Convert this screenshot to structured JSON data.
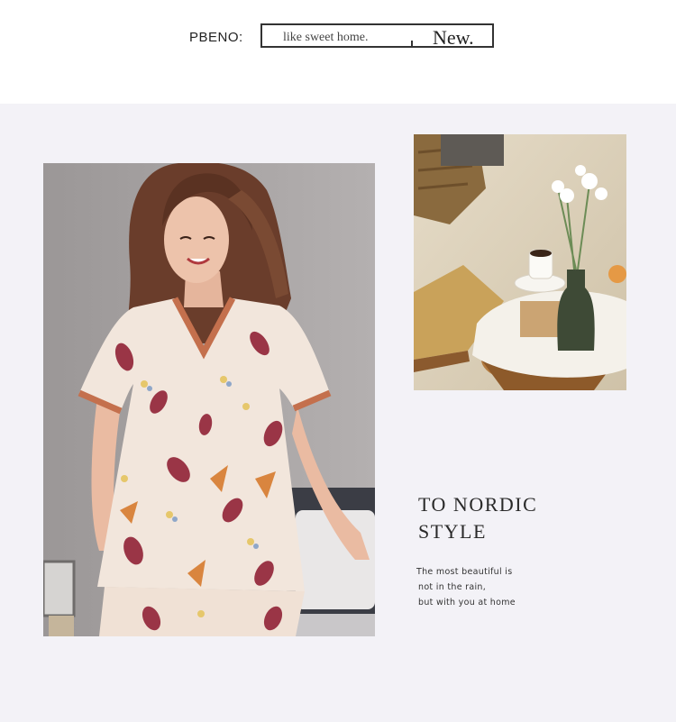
{
  "header": {
    "brand": "PBENO:",
    "tagline_left": "like sweet home.",
    "tagline_right": "New."
  },
  "feature": {
    "headline_line1": "TO NORDIC",
    "headline_line2": "STYLE",
    "caption_line1": "The most beautiful is",
    "caption_line2": "not in the rain,",
    "caption_line3": "but with you at home"
  },
  "colors": {
    "panel_background": "#f3f2f7",
    "pajama_base": "#f2e6dc",
    "trim_orange": "#c4704d",
    "leaf_burgundy": "#9a3546"
  }
}
